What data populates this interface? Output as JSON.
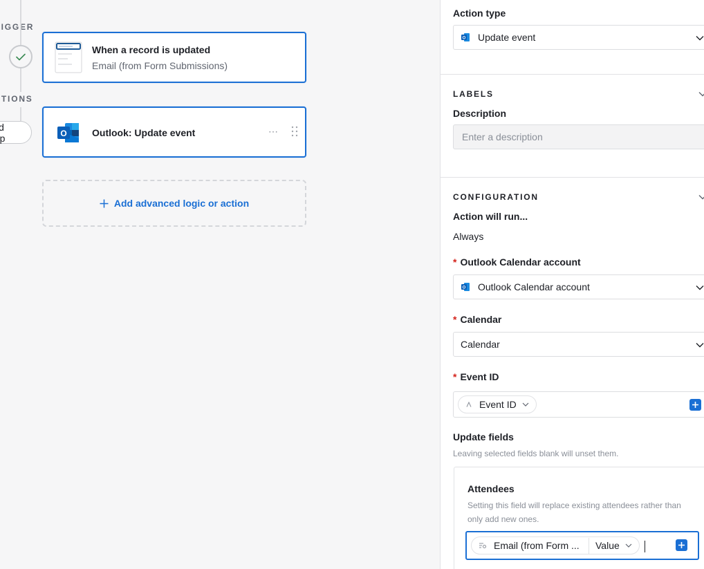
{
  "canvas": {
    "trigger_section": "TRIGGER",
    "actions_section": "ACTIONS",
    "add_step_label": "Add step",
    "trigger_card": {
      "title": "When a record is updated",
      "subtitle": "Email (from Form Submissions)"
    },
    "action_card": {
      "title": "Outlook: Update event",
      "more_icon": "ellipsis-icon",
      "drag_icon": "drag-handle-icon"
    },
    "add_logic_label": "Add advanced logic or action"
  },
  "panel": {
    "action_type": {
      "label": "Action type",
      "value": "Update event",
      "icon": "outlook-icon"
    },
    "labels_section": "LABELS",
    "description": {
      "label": "Description",
      "placeholder": "Enter a description"
    },
    "configuration_section": "CONFIGURATION",
    "action_will_run": {
      "label": "Action will run...",
      "value": "Always"
    },
    "outlook_account": {
      "label": "Outlook Calendar account",
      "value": "Outlook Calendar account",
      "required": "*"
    },
    "calendar": {
      "label": "Calendar",
      "value": "Calendar",
      "required": "*"
    },
    "event_id": {
      "label": "Event ID",
      "token": "Event ID",
      "required": "*"
    },
    "update_fields": {
      "label": "Update fields",
      "hint": "Leaving selected fields blank will unset them."
    },
    "attendees": {
      "label": "Attendees",
      "hint": "Setting this field will replace existing attendees rather than only add new ones.",
      "token_field": "Email (from Form ...",
      "token_value": "Value"
    }
  },
  "colors": {
    "accent": "#1a6fd4",
    "required": "#d4231b",
    "outlook_blue": "#0a64c9"
  }
}
